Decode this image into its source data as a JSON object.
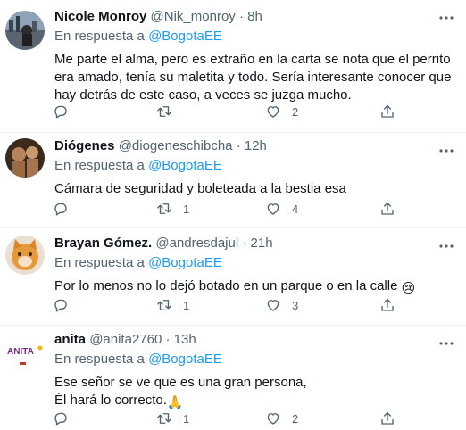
{
  "colors": {
    "accent": "#1d9bf0",
    "muted": "#536471",
    "text": "#0f1419",
    "divider": "#eff3f4"
  },
  "tweets": [
    {
      "name": "Nicole Monroy",
      "handle": "@Nik_monroy",
      "dot": "·",
      "time": "8h",
      "reply_prefix": "En respuesta a",
      "reply_to": "@BogotaEE",
      "text": "Me parte el alma, pero es extraño en la carta se nota que el perrito era amado, tenía su maletita y todo. Sería interesante conocer que hay detrás de este caso, a veces se juzga mucho.",
      "emoji": "",
      "retweets": "",
      "likes": "2"
    },
    {
      "name": "Diógenes",
      "handle": "@diogeneschibcha",
      "dot": "·",
      "time": "12h",
      "reply_prefix": "En respuesta a",
      "reply_to": "@BogotaEE",
      "text": "Cámara de seguridad y boleteada a la bestia esa",
      "emoji": "",
      "retweets": "1",
      "likes": "4"
    },
    {
      "name": "Brayan Gómez.",
      "handle": "@andresdajul",
      "dot": "·",
      "time": "21h",
      "reply_prefix": "En respuesta a",
      "reply_to": "@BogotaEE",
      "text": "Por lo menos no lo dejó botado en un parque o en la calle ",
      "emoji": "😢",
      "retweets": "1",
      "likes": "3"
    },
    {
      "name": "anita",
      "handle": "@anita2760",
      "dot": "·",
      "time": "13h",
      "reply_prefix": "En respuesta a",
      "reply_to": "@BogotaEE",
      "text_line1": "Ese señor se ve que es una gran persona,",
      "text_line2": "Él hará lo correcto.",
      "emoji": "🙏",
      "retweets": "1",
      "likes": "2",
      "avatar_logo": "ANITA"
    }
  ]
}
